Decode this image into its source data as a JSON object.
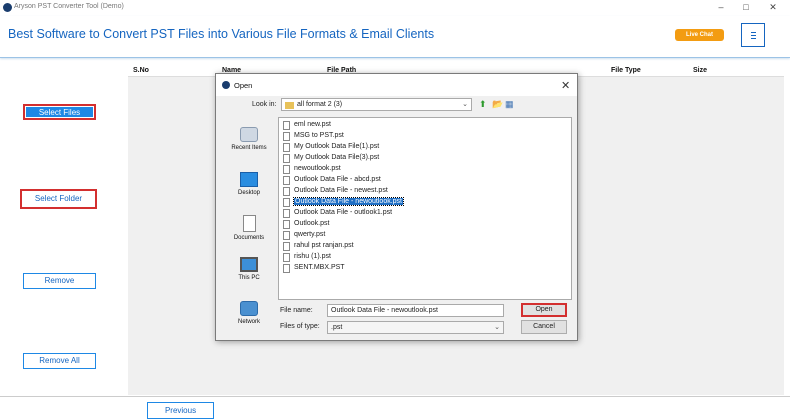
{
  "window": {
    "title": "Aryson PST Converter Tool (Demo)",
    "minimize": "–",
    "maximize": "□",
    "close": "✕"
  },
  "header": {
    "tagline": "Best Software to Convert PST Files into Various File Formats & Email Clients",
    "live_chat": "Live Chat",
    "menu_icon": "hamburger-icon"
  },
  "sidebar": {
    "select_files": "Select Files",
    "select_folder": "Select Folder",
    "remove": "Remove",
    "remove_all": "Remove All"
  },
  "table": {
    "columns": [
      "S.No",
      "Name",
      "File Path",
      "File Type",
      "Size"
    ]
  },
  "footer": {
    "previous": "Previous"
  },
  "dialog": {
    "title": "Open",
    "close": "✕",
    "look_in_label": "Look in:",
    "look_in_value": "all format 2 (3)",
    "places": [
      "Recent Items",
      "Desktop",
      "Documents",
      "This PC",
      "Network"
    ],
    "files": [
      "eml new.pst",
      "MSG to PST.pst",
      "My Outlook Data File(1).pst",
      "My Outlook Data File(3).pst",
      "newoutlook.pst",
      "Outlook Data File - abcd.pst",
      "Outlook Data File - newest.pst",
      "Outlook Data File - newoutlook.pst",
      "Outlook Data File - outlook1.pst",
      "Outlook.pst",
      "qwerty.pst",
      "rahul pst ranjan.pst",
      "rishu (1).pst",
      "SENT.MBX.PST"
    ],
    "selected_file": "Outlook Data File - newoutlook.pst",
    "file_name_label": "File name:",
    "file_name_value": "Outlook Data File - newoutlook.pst",
    "file_type_label": "Files of type:",
    "file_type_value": ".pst",
    "open_button": "Open",
    "cancel_button": "Cancel"
  },
  "colors": {
    "accent": "#1e88e5",
    "highlight": "#d32f2f",
    "live_chat": "#f39c12",
    "selection": "#1f6fc5"
  }
}
